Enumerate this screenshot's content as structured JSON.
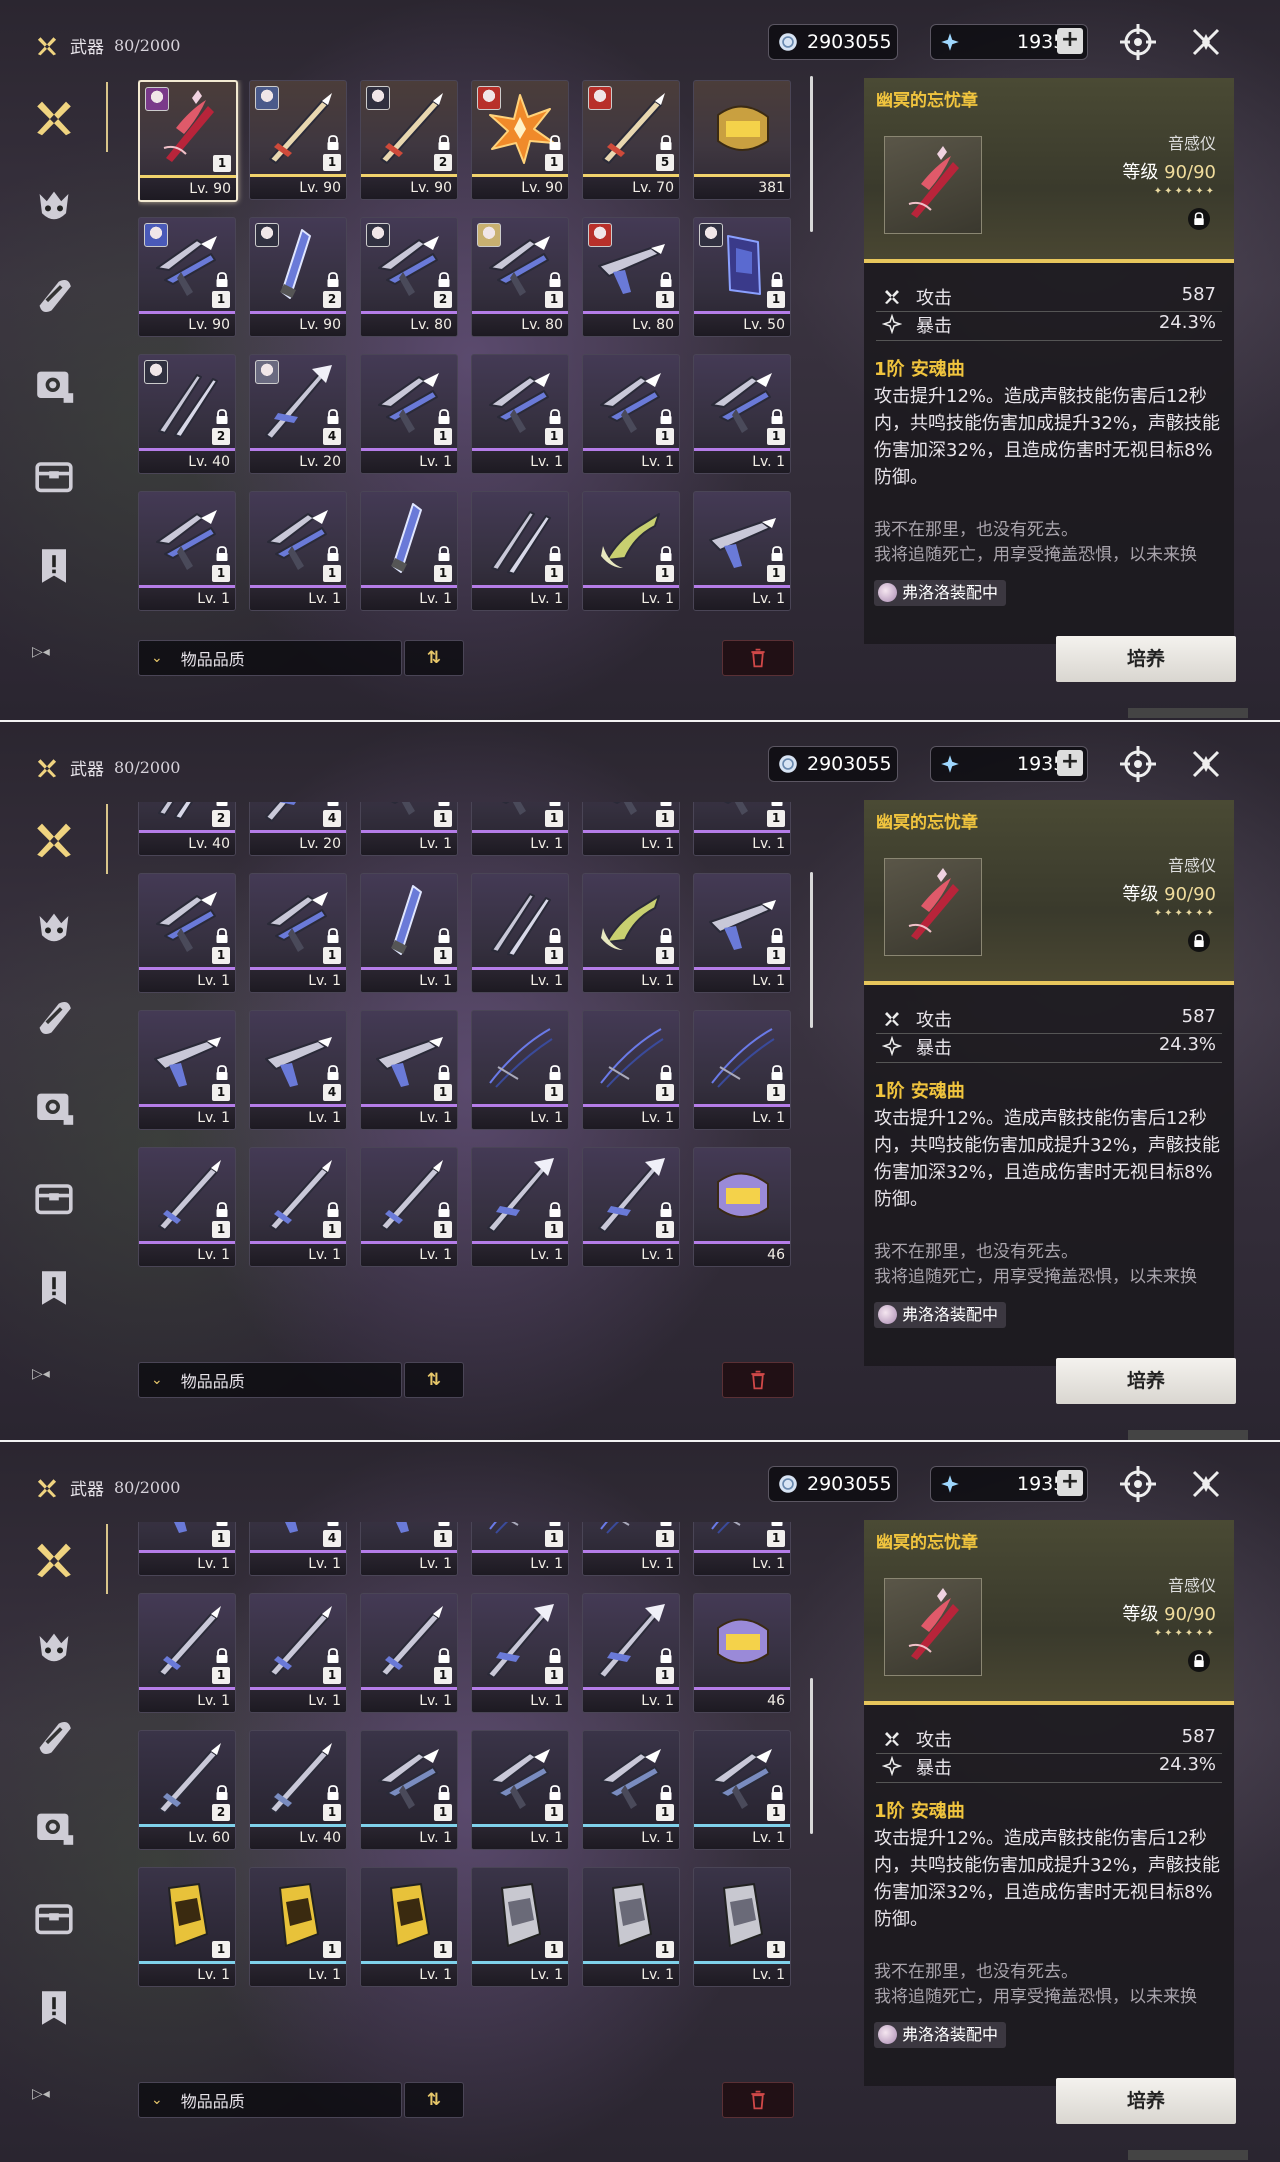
{
  "topbar": {
    "category": "武器",
    "count": "80/2000",
    "shell_credit": "2903055",
    "astrite": "1935",
    "plus": "+"
  },
  "sidebar": [
    "weapon-icon",
    "echo-icon",
    "devkit-icon",
    "resource-icon",
    "supply-icon",
    "special-icon"
  ],
  "sort": {
    "label": "物品品质",
    "chevron": "⌄",
    "direction": "⇅"
  },
  "detail": {
    "name": "幽冥的忘忧章",
    "type": "音感仪",
    "level_label": "等级",
    "level": "90",
    "level_max": "/90",
    "stars": "✦✦✦✦✦✦",
    "stats": [
      {
        "name": "攻击",
        "value": "587"
      },
      {
        "name": "暴击",
        "value": "24.3%"
      }
    ],
    "skill_rank": "1阶",
    "skill_name": "安魂曲",
    "skill_desc": "攻击提升12%。造成声骸技能伤害后12秒内，共鸣技能伤害加成提升32%，声骸技能伤害加深32%，且造成伤害时无视目标8%防御。",
    "flavor_1": "我不在那里，也没有死去。",
    "flavor_2": "我将追随死亡，用享受掩盖恐惧，以未来换",
    "equipped": "弗洛洛装配中",
    "cultivate": "培养"
  },
  "colors": {
    "gold": "#f0c43e",
    "purple": "#b57de8",
    "blue": "#7fd1ea",
    "five_star": "#f1d36c"
  },
  "panels": [
    {
      "rows": [
        [
          {
            "kind": "harp",
            "rarity": 5,
            "num": "1",
            "lv": "Lv. 90",
            "avatar": "#7a3a8a",
            "sel": true
          },
          {
            "kind": "sword",
            "rarity": 5,
            "num": "1",
            "lv": "Lv. 90",
            "avatar": "#4a5a8a",
            "lock": true
          },
          {
            "kind": "sword",
            "rarity": 5,
            "num": "2",
            "lv": "Lv. 90",
            "avatar": "#303040",
            "lock": true
          },
          {
            "kind": "flame",
            "rarity": 5,
            "num": "1",
            "lv": "Lv. 90",
            "avatar": "#b8302a",
            "lock": true
          },
          {
            "kind": "sword",
            "rarity": 5,
            "num": "5",
            "lv": "Lv. 70",
            "avatar": "#b8302a",
            "lock": true
          },
          {
            "kind": "tube",
            "rarity": 5,
            "lv": "381"
          }
        ],
        [
          {
            "kind": "claw",
            "rarity": 4,
            "num": "1",
            "lv": "Lv. 90",
            "avatar": "#4a5ab8",
            "lock": true
          },
          {
            "kind": "blade",
            "rarity": 4,
            "num": "2",
            "lv": "Lv. 90",
            "avatar": "#303040",
            "lock": true
          },
          {
            "kind": "claw",
            "rarity": 4,
            "num": "2",
            "lv": "Lv. 80",
            "avatar": "#303040",
            "lock": true
          },
          {
            "kind": "claw",
            "rarity": 4,
            "num": "1",
            "lv": "Lv. 80",
            "avatar": "#c8b070",
            "lock": true
          },
          {
            "kind": "gun",
            "rarity": 4,
            "num": "1",
            "lv": "Lv. 80",
            "avatar": "#b8302a",
            "lock": true
          },
          {
            "kind": "bag",
            "rarity": 4,
            "num": "1",
            "lv": "Lv. 50",
            "avatar": "#303040",
            "lock": true
          }
        ],
        [
          {
            "kind": "pair",
            "rarity": 4,
            "num": "2",
            "lv": "Lv. 40",
            "avatar": "#303040",
            "lock": true
          },
          {
            "kind": "spear",
            "rarity": 4,
            "num": "4",
            "lv": "Lv. 20",
            "avatar": "#6a6a80",
            "lock": true
          },
          {
            "kind": "claw",
            "rarity": 4,
            "num": "1",
            "lv": "Lv. 1",
            "lock": true
          },
          {
            "kind": "claw",
            "rarity": 4,
            "num": "1",
            "lv": "Lv. 1",
            "lock": true
          },
          {
            "kind": "claw",
            "rarity": 4,
            "num": "1",
            "lv": "Lv. 1",
            "lock": true
          },
          {
            "kind": "claw",
            "rarity": 4,
            "num": "1",
            "lv": "Lv. 1",
            "lock": true
          }
        ],
        [
          {
            "kind": "claw",
            "rarity": 4,
            "num": "1",
            "lv": "Lv. 1",
            "lock": true
          },
          {
            "kind": "claw",
            "rarity": 4,
            "num": "1",
            "lv": "Lv. 1",
            "lock": true
          },
          {
            "kind": "blade",
            "rarity": 4,
            "num": "1",
            "lv": "Lv. 1",
            "lock": true
          },
          {
            "kind": "pair",
            "rarity": 4,
            "num": "1",
            "lv": "Lv. 1",
            "lock": true
          },
          {
            "kind": "hook",
            "rarity": 4,
            "num": "1",
            "lv": "Lv. 1",
            "lock": true
          },
          {
            "kind": "gun",
            "rarity": 4,
            "num": "1",
            "lv": "Lv. 1",
            "lock": true
          }
        ]
      ]
    },
    {
      "rows": [
        [
          {
            "kind": "pair",
            "rarity": 4,
            "num": "2",
            "lv": "Lv. 40",
            "avatar": "#303040",
            "lock": true
          },
          {
            "kind": "spear",
            "rarity": 4,
            "num": "4",
            "lv": "Lv. 20",
            "avatar": "#6a6a80",
            "lock": true
          },
          {
            "kind": "claw",
            "rarity": 4,
            "num": "1",
            "lv": "Lv. 1",
            "lock": true
          },
          {
            "kind": "claw",
            "rarity": 4,
            "num": "1",
            "lv": "Lv. 1",
            "lock": true
          },
          {
            "kind": "claw",
            "rarity": 4,
            "num": "1",
            "lv": "Lv. 1",
            "lock": true
          },
          {
            "kind": "claw",
            "rarity": 4,
            "num": "1",
            "lv": "Lv. 1",
            "lock": true
          }
        ],
        [
          {
            "kind": "claw",
            "rarity": 4,
            "num": "1",
            "lv": "Lv. 1",
            "lock": true
          },
          {
            "kind": "claw",
            "rarity": 4,
            "num": "1",
            "lv": "Lv. 1",
            "lock": true
          },
          {
            "kind": "blade",
            "rarity": 4,
            "num": "1",
            "lv": "Lv. 1",
            "lock": true
          },
          {
            "kind": "pair",
            "rarity": 4,
            "num": "1",
            "lv": "Lv. 1",
            "lock": true
          },
          {
            "kind": "hook",
            "rarity": 4,
            "num": "1",
            "lv": "Lv. 1",
            "lock": true
          },
          {
            "kind": "gun",
            "rarity": 4,
            "num": "1",
            "lv": "Lv. 1",
            "lock": true
          }
        ],
        [
          {
            "kind": "gun",
            "rarity": 4,
            "num": "1",
            "lv": "Lv. 1",
            "lock": true
          },
          {
            "kind": "gun",
            "rarity": 4,
            "num": "4",
            "lv": "Lv. 1",
            "lock": true
          },
          {
            "kind": "gun",
            "rarity": 4,
            "num": "1",
            "lv": "Lv. 1",
            "lock": true
          },
          {
            "kind": "bow",
            "rarity": 4,
            "num": "1",
            "lv": "Lv. 1",
            "lock": true
          },
          {
            "kind": "bow",
            "rarity": 4,
            "num": "1",
            "lv": "Lv. 1",
            "lock": true
          },
          {
            "kind": "bow",
            "rarity": 4,
            "num": "1",
            "lv": "Lv. 1",
            "lock": true
          }
        ],
        [
          {
            "kind": "sword",
            "rarity": 4,
            "num": "1",
            "lv": "Lv. 1",
            "lock": true
          },
          {
            "kind": "sword",
            "rarity": 4,
            "num": "1",
            "lv": "Lv. 1",
            "lock": true
          },
          {
            "kind": "sword",
            "rarity": 4,
            "num": "1",
            "lv": "Lv. 1",
            "lock": true
          },
          {
            "kind": "spear",
            "rarity": 4,
            "num": "1",
            "lv": "Lv. 1",
            "lock": true
          },
          {
            "kind": "spear",
            "rarity": 4,
            "num": "1",
            "lv": "Lv. 1",
            "lock": true
          },
          {
            "kind": "tube",
            "rarity": 4,
            "lv": "46"
          }
        ]
      ]
    },
    {
      "rows": [
        [
          {
            "kind": "gun",
            "rarity": 4,
            "num": "1",
            "lv": "Lv. 1",
            "lock": true
          },
          {
            "kind": "gun",
            "rarity": 4,
            "num": "4",
            "lv": "Lv. 1",
            "lock": true
          },
          {
            "kind": "gun",
            "rarity": 4,
            "num": "1",
            "lv": "Lv. 1",
            "lock": true
          },
          {
            "kind": "bow",
            "rarity": 4,
            "num": "1",
            "lv": "Lv. 1",
            "lock": true
          },
          {
            "kind": "bow",
            "rarity": 4,
            "num": "1",
            "lv": "Lv. 1",
            "lock": true
          },
          {
            "kind": "bow",
            "rarity": 4,
            "num": "1",
            "lv": "Lv. 1",
            "lock": true
          }
        ],
        [
          {
            "kind": "sword",
            "rarity": 4,
            "num": "1",
            "lv": "Lv. 1",
            "lock": true
          },
          {
            "kind": "sword",
            "rarity": 4,
            "num": "1",
            "lv": "Lv. 1",
            "lock": true
          },
          {
            "kind": "sword",
            "rarity": 4,
            "num": "1",
            "lv": "Lv. 1",
            "lock": true
          },
          {
            "kind": "spear",
            "rarity": 4,
            "num": "1",
            "lv": "Lv. 1",
            "lock": true
          },
          {
            "kind": "spear",
            "rarity": 4,
            "num": "1",
            "lv": "Lv. 1",
            "lock": true
          },
          {
            "kind": "tube",
            "rarity": 4,
            "lv": "46"
          }
        ],
        [
          {
            "kind": "sword",
            "rarity": 3,
            "num": "2",
            "lv": "Lv. 60",
            "lock": true
          },
          {
            "kind": "sword",
            "rarity": 3,
            "num": "1",
            "lv": "Lv. 40",
            "lock": true
          },
          {
            "kind": "claw",
            "rarity": 3,
            "num": "1",
            "lv": "Lv. 1",
            "lock": true
          },
          {
            "kind": "claw",
            "rarity": 3,
            "num": "1",
            "lv": "Lv. 1",
            "lock": true
          },
          {
            "kind": "claw",
            "rarity": 3,
            "num": "1",
            "lv": "Lv. 1",
            "lock": true
          },
          {
            "kind": "claw",
            "rarity": 3,
            "num": "1",
            "lv": "Lv. 1",
            "lock": true
          }
        ],
        [
          {
            "kind": "gauntlet",
            "rarity": 3,
            "num": "1",
            "lv": "Lv. 1",
            "gold": true
          },
          {
            "kind": "gauntlet",
            "rarity": 3,
            "num": "1",
            "lv": "Lv. 1",
            "gold": true
          },
          {
            "kind": "gauntlet",
            "rarity": 3,
            "num": "1",
            "lv": "Lv. 1",
            "gold": true
          },
          {
            "kind": "gauntlet",
            "rarity": 3,
            "num": "1",
            "lv": "Lv. 1"
          },
          {
            "kind": "gauntlet",
            "rarity": 3,
            "num": "1",
            "lv": "Lv. 1"
          },
          {
            "kind": "gauntlet",
            "rarity": 3,
            "num": "1",
            "lv": "Lv. 1"
          }
        ]
      ]
    }
  ]
}
